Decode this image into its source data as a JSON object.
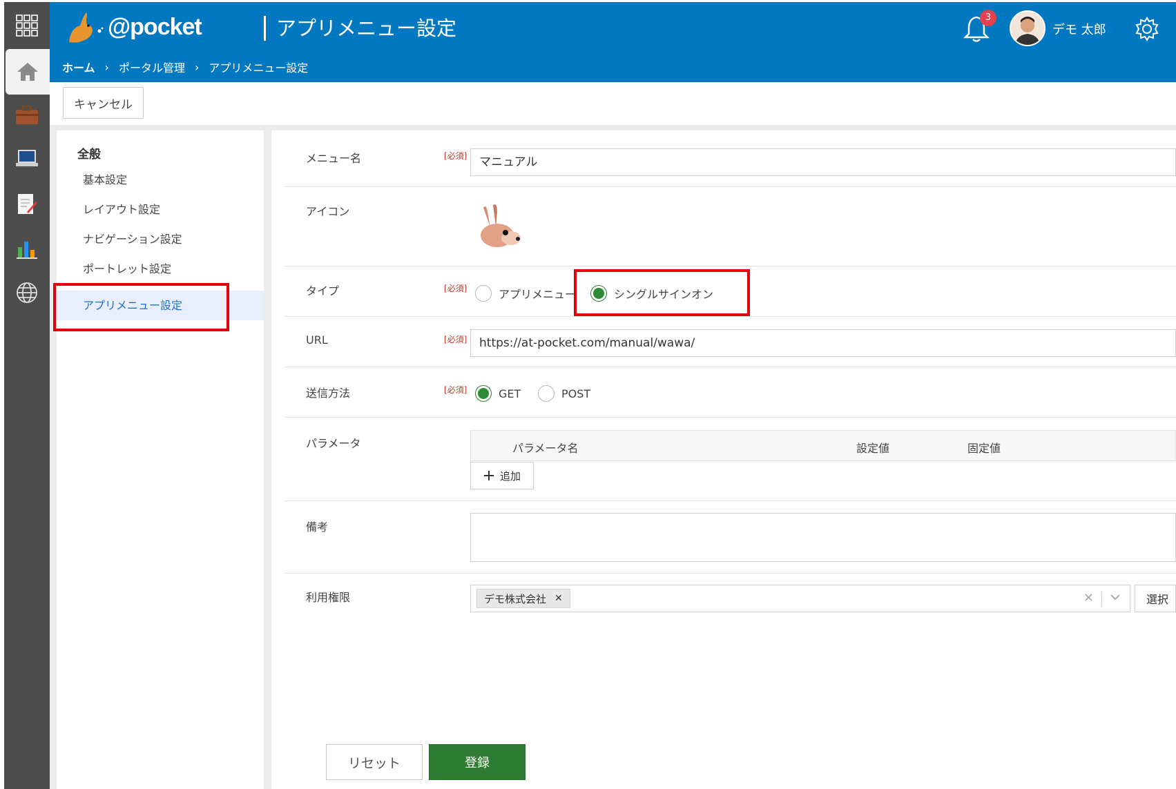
{
  "header": {
    "logo_text": "@pocket",
    "title": "アプリメニュー設定",
    "breadcrumb": [
      "ホーム",
      "ポータル管理",
      "アプリメニュー設定"
    ],
    "breadcrumb_sep": "›",
    "notification_count": "3",
    "user_name": "デモ 太郎"
  },
  "toolbar": {
    "cancel_label": "キャンセル"
  },
  "sidenav": {
    "group": "全般",
    "items": [
      {
        "label": "基本設定"
      },
      {
        "label": "レイアウト設定"
      },
      {
        "label": "ナビゲーション設定"
      },
      {
        "label": "ポートレット設定"
      },
      {
        "label": "アプリメニュー設定",
        "active": true
      }
    ]
  },
  "form": {
    "required_tag": "[必須]",
    "menu_name": {
      "label": "メニュー名",
      "value": "マニュアル"
    },
    "icon": {
      "label": "アイコン"
    },
    "type": {
      "label": "タイプ",
      "options": [
        "アプリメニュー",
        "シングルサインオン"
      ],
      "selected": "シングルサインオン"
    },
    "url": {
      "label": "URL",
      "value": "https://at-pocket.com/manual/wawa/"
    },
    "method": {
      "label": "送信方法",
      "options": [
        "GET",
        "POST"
      ],
      "selected": "GET"
    },
    "params": {
      "label": "パラメータ",
      "columns": [
        "パラメータ名",
        "設定値",
        "固定値"
      ],
      "add_label": "追加"
    },
    "note": {
      "label": "備考",
      "value": ""
    },
    "permission": {
      "label": "利用権限",
      "tags": [
        "デモ株式会社"
      ],
      "select_label": "選択"
    }
  },
  "actions": {
    "reset_label": "リセット",
    "submit_label": "登録"
  },
  "colors": {
    "header": "#0278c0",
    "submit": "#2f7d32",
    "highlight": "#e6000f",
    "rail": "#4d4d4d"
  }
}
